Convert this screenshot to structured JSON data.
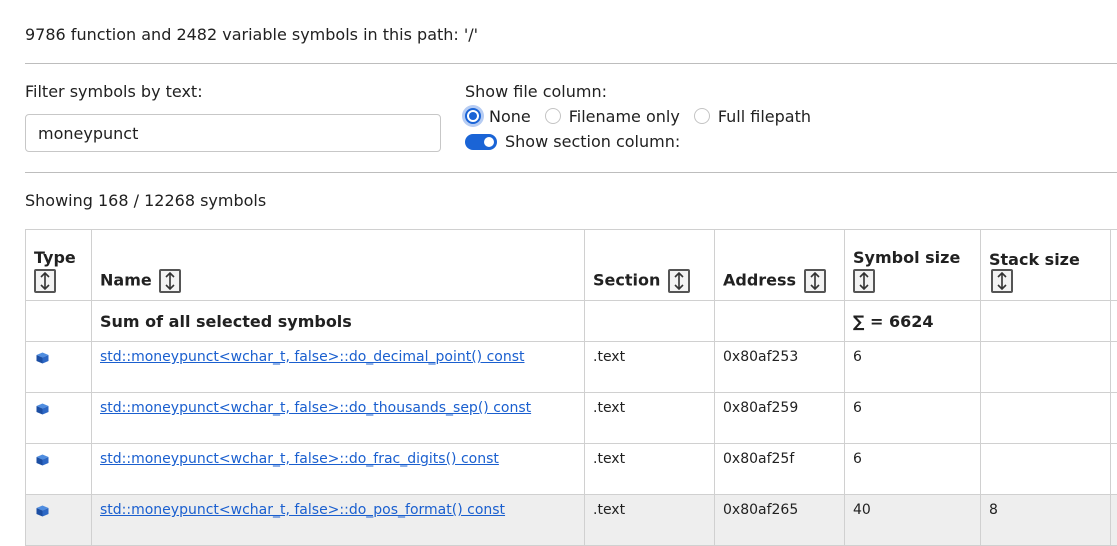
{
  "summary": "9786 function and 2482 variable symbols in this path: '/'",
  "filter": {
    "label": "Filter symbols by text:",
    "value": "moneypunct"
  },
  "file_column": {
    "label": "Show file column:",
    "options": [
      "None",
      "Filename only",
      "Full filepath"
    ],
    "selected": "None"
  },
  "section_toggle": {
    "label": "Show section column:",
    "on": true
  },
  "showing": "Showing 168 / 12268 symbols",
  "table": {
    "headers": {
      "type": "Type",
      "name": "Name",
      "section": "Section",
      "address": "Address",
      "symbol_size": "Symbol size",
      "stack_size": "Stack size"
    },
    "sum_row": {
      "label": "Sum of all selected symbols",
      "symbol_size": "∑ = 6624"
    },
    "rows": [
      {
        "name": "std::moneypunct<wchar_t, false>::do_decimal_point() const",
        "section": ".text",
        "address": "0x80af253",
        "symbol_size": "6",
        "stack_size": "",
        "type_icon": "function-cube-icon"
      },
      {
        "name": "std::moneypunct<wchar_t, false>::do_thousands_sep() const",
        "section": ".text",
        "address": "0x80af259",
        "symbol_size": "6",
        "stack_size": "",
        "type_icon": "function-cube-icon"
      },
      {
        "name": "std::moneypunct<wchar_t, false>::do_frac_digits() const",
        "section": ".text",
        "address": "0x80af25f",
        "symbol_size": "6",
        "stack_size": "",
        "type_icon": "function-cube-icon"
      },
      {
        "name": "std::moneypunct<wchar_t, false>::do_pos_format() const",
        "section": ".text",
        "address": "0x80af265",
        "symbol_size": "40",
        "stack_size": "8",
        "type_icon": "function-cube-icon"
      }
    ]
  },
  "colors": {
    "accent": "#1a64d6",
    "link": "#1a5fcf",
    "highlight_row": "#eeeeee"
  }
}
